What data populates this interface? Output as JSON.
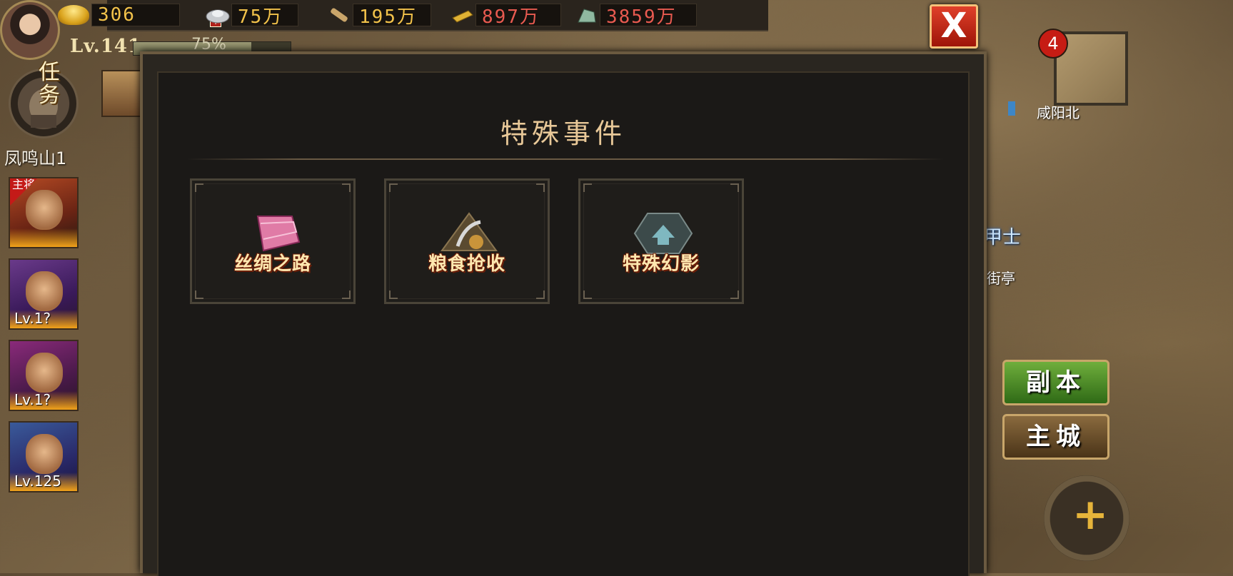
{
  "resources": {
    "gold": "306",
    "silver": "75万",
    "wood": "195万",
    "iron": "897万",
    "jade": "3859万"
  },
  "player": {
    "level": "Lv.141",
    "exp_percent": "75%",
    "exp_fraction": 0.75
  },
  "left": {
    "quest_label": "任务",
    "location": "凤鸣山1",
    "heroes": [
      {
        "main_tag": "主将",
        "level": ""
      },
      {
        "level": "Lv.1?"
      },
      {
        "level": "Lv.1?"
      },
      {
        "level": "Lv.125"
      }
    ]
  },
  "minimap": {
    "badge": "4",
    "name": "咸阳北"
  },
  "map_labels": {
    "armor": "甲士",
    "pavilion": "街亭"
  },
  "right_buttons": {
    "dungeon": "副本",
    "city": "主城"
  },
  "modal": {
    "title": "特殊事件",
    "close": "X",
    "events": [
      {
        "label": "丝绸之路",
        "icon": "silk-icon"
      },
      {
        "label": "粮食抢收",
        "icon": "harvest-icon"
      },
      {
        "label": "特殊幻影",
        "icon": "phantom-icon"
      }
    ]
  },
  "colors": {
    "title": "#e8c898",
    "event_label": "#ffe8b0",
    "iron_value": "#e85a50",
    "gold_value": "#f2c24a",
    "dungeon_button": "#4e8c28"
  }
}
